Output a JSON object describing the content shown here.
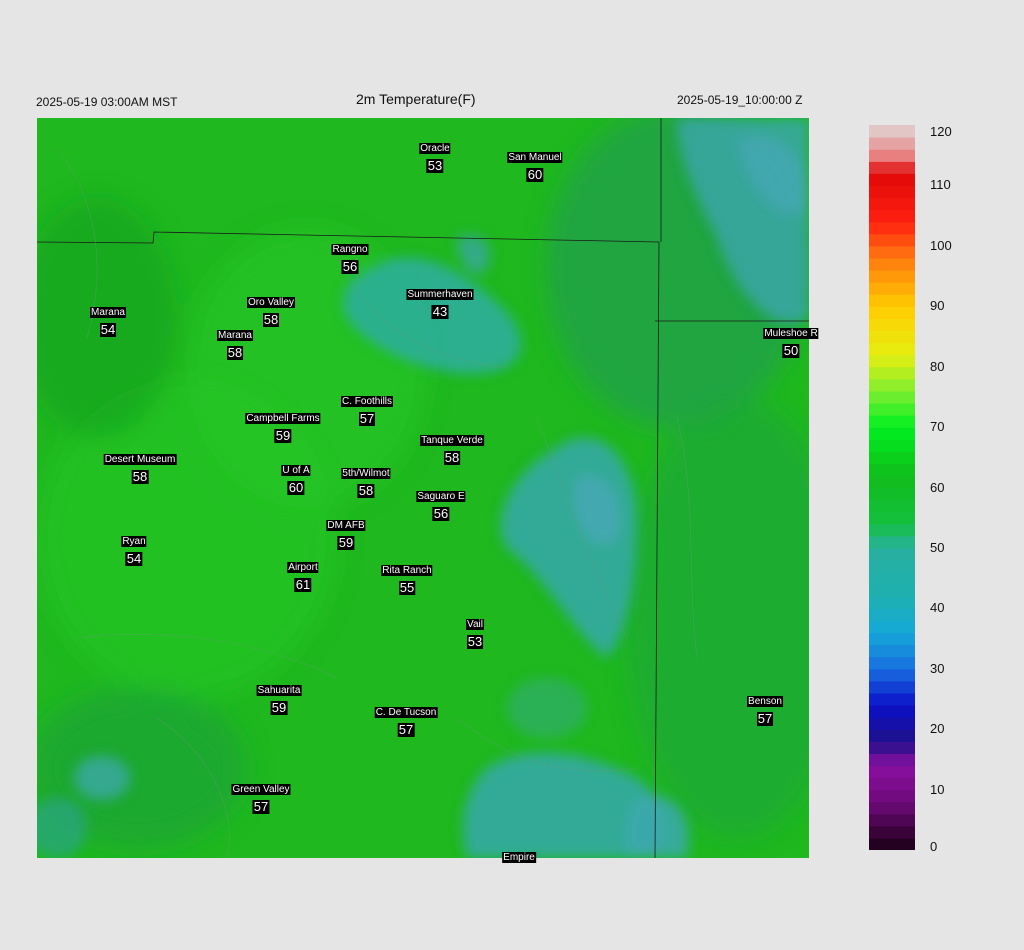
{
  "header": {
    "local_time": "2025-05-19 03:00AM MST",
    "title": "2m Temperature(F)",
    "utc_time": "2025-05-19_10:00:00 Z"
  },
  "colors": {
    "background": "#e5e5e5",
    "warm_green": "#1fb81f",
    "cool_teal": "#2aa8a0",
    "boundary_line": "#1a1a1a"
  },
  "stations": [
    {
      "name": "Oracle",
      "value": "53"
    },
    {
      "name": "San Manuel",
      "value": "60"
    },
    {
      "name": "Rangno",
      "value": "56"
    },
    {
      "name": "Marana",
      "value": "54"
    },
    {
      "name": "Oro Valley",
      "value": "58"
    },
    {
      "name": "Summerhaven",
      "value": "43"
    },
    {
      "name": "Marana",
      "value": "58"
    },
    {
      "name": "Muleshoe R",
      "value": "50"
    },
    {
      "name": "C. Foothills",
      "value": "57"
    },
    {
      "name": "Campbell Farms",
      "value": "59"
    },
    {
      "name": "Tanque Verde",
      "value": "58"
    },
    {
      "name": "Desert Museum",
      "value": "58"
    },
    {
      "name": "U of A",
      "value": "60"
    },
    {
      "name": "5th/Wilmot",
      "value": "58"
    },
    {
      "name": "Saguaro E",
      "value": "56"
    },
    {
      "name": "DM AFB",
      "value": "59"
    },
    {
      "name": "Ryan",
      "value": "54"
    },
    {
      "name": "Airport",
      "value": "61"
    },
    {
      "name": "Rita Ranch",
      "value": "55"
    },
    {
      "name": "Vail",
      "value": "53"
    },
    {
      "name": "Sahuarita",
      "value": "59"
    },
    {
      "name": "C. De Tucson",
      "value": "57"
    },
    {
      "name": "Benson",
      "value": "57"
    },
    {
      "name": "Green Valley",
      "value": "57"
    },
    {
      "name": "Empire",
      "value": ""
    }
  ],
  "colorbar": {
    "ticks": [
      "120",
      "110",
      "100",
      "90",
      "80",
      "70",
      "60",
      "50",
      "40",
      "30",
      "20",
      "10",
      "0"
    ],
    "min": 0,
    "max": 120
  }
}
